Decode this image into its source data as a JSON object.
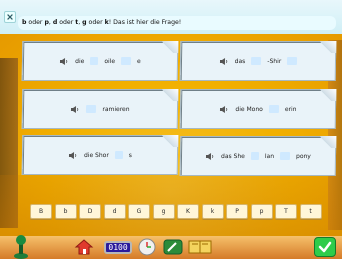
{
  "prompt": {
    "text_parts": [
      {
        "text": "b",
        "bold": true
      },
      {
        "text": " oder ",
        "bold": false
      },
      {
        "text": "p",
        "bold": true
      },
      {
        "text": ", ",
        "bold": false
      },
      {
        "text": "d",
        "bold": true
      },
      {
        "text": " oder ",
        "bold": false
      },
      {
        "text": "t",
        "bold": true
      },
      {
        "text": ", ",
        "bold": false
      },
      {
        "text": "g",
        "bold": true
      },
      {
        "text": " oder ",
        "bold": false
      },
      {
        "text": "k",
        "bold": true
      },
      {
        "text": "! Das ist hier die Frage!",
        "bold": false
      }
    ]
  },
  "cards": [
    {
      "id": "card1",
      "word_parts": [
        {
          "t": "die "
        },
        {
          "blank": true
        },
        {
          "t": "oile"
        },
        {
          "blank": true
        },
        {
          "t": "e"
        }
      ]
    },
    {
      "id": "card2",
      "word_parts": [
        {
          "t": "das "
        },
        {
          "blank": true
        },
        {
          "t": "-Shir"
        },
        {
          "blank": true
        }
      ]
    },
    {
      "id": "card3",
      "word_parts": [
        {
          "blank": true
        },
        {
          "t": "ramieren"
        }
      ]
    },
    {
      "id": "card4",
      "word_parts": [
        {
          "t": "die Mono"
        },
        {
          "blank": true
        },
        {
          "t": "erin"
        }
      ]
    },
    {
      "id": "card5",
      "word_parts": [
        {
          "t": "die Shor"
        },
        {
          "blank": true
        },
        {
          "t": "s"
        }
      ]
    },
    {
      "id": "card6",
      "word_parts": [
        {
          "t": "das She"
        },
        {
          "blank": true
        },
        {
          "t": "lan"
        },
        {
          "blank": true
        },
        {
          "t": "pony"
        }
      ]
    }
  ],
  "letters": [
    "B",
    "b",
    "D",
    "d",
    "G",
    "g",
    "K",
    "k",
    "P",
    "p",
    "T",
    "t"
  ],
  "toolbar": {
    "counter": "0100"
  },
  "icons": {
    "speaker": "speaker-icon",
    "close": "close-icon",
    "ok": "checkmark-icon"
  },
  "colors": {
    "accent_green": "#2ecc4a",
    "counter_bg": "#2b1b9c",
    "card_bg": "#e9f3f9"
  }
}
